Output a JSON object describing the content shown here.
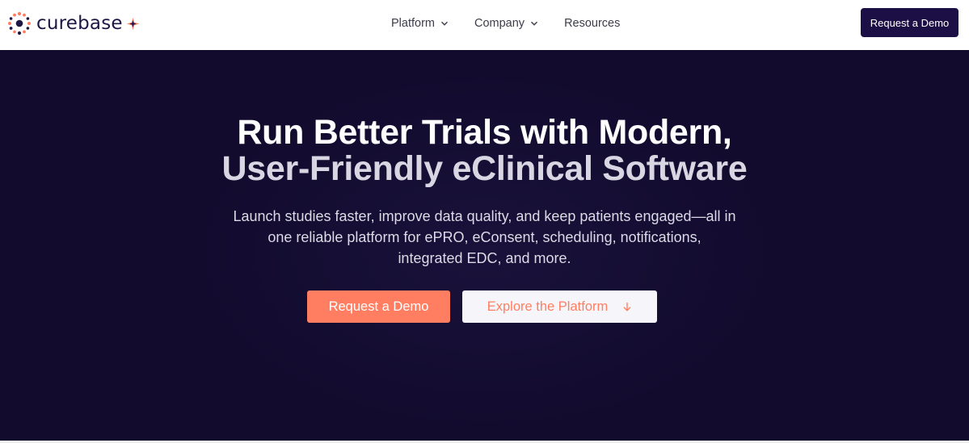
{
  "brand": {
    "name": "curebase",
    "logo_icon": "dotted-circle-logo-icon",
    "spark_icon": "sparkle-icon",
    "colors": {
      "navy": "#1c0f45",
      "coral": "#ff7e61",
      "hero_bg": "#120b2e"
    }
  },
  "nav": {
    "items": [
      {
        "label": "Platform",
        "has_dropdown": true
      },
      {
        "label": "Company",
        "has_dropdown": true
      },
      {
        "label": "Resources",
        "has_dropdown": false
      }
    ],
    "cta_label": "Request a Demo"
  },
  "hero": {
    "title_line1": "Run Better Trials with Modern,",
    "title_line2": "User-Friendly eClinical Software",
    "subtitle_line1": "Launch studies faster, improve data quality, and keep patients engaged—all in",
    "subtitle_line2": "one reliable platform for ePRO, eConsent, scheduling, notifications,",
    "subtitle_line3": "integrated EDC, and more.",
    "primary_button": "Request a Demo",
    "secondary_button": "Explore the Platform",
    "secondary_icon": "arrow-down-icon"
  }
}
